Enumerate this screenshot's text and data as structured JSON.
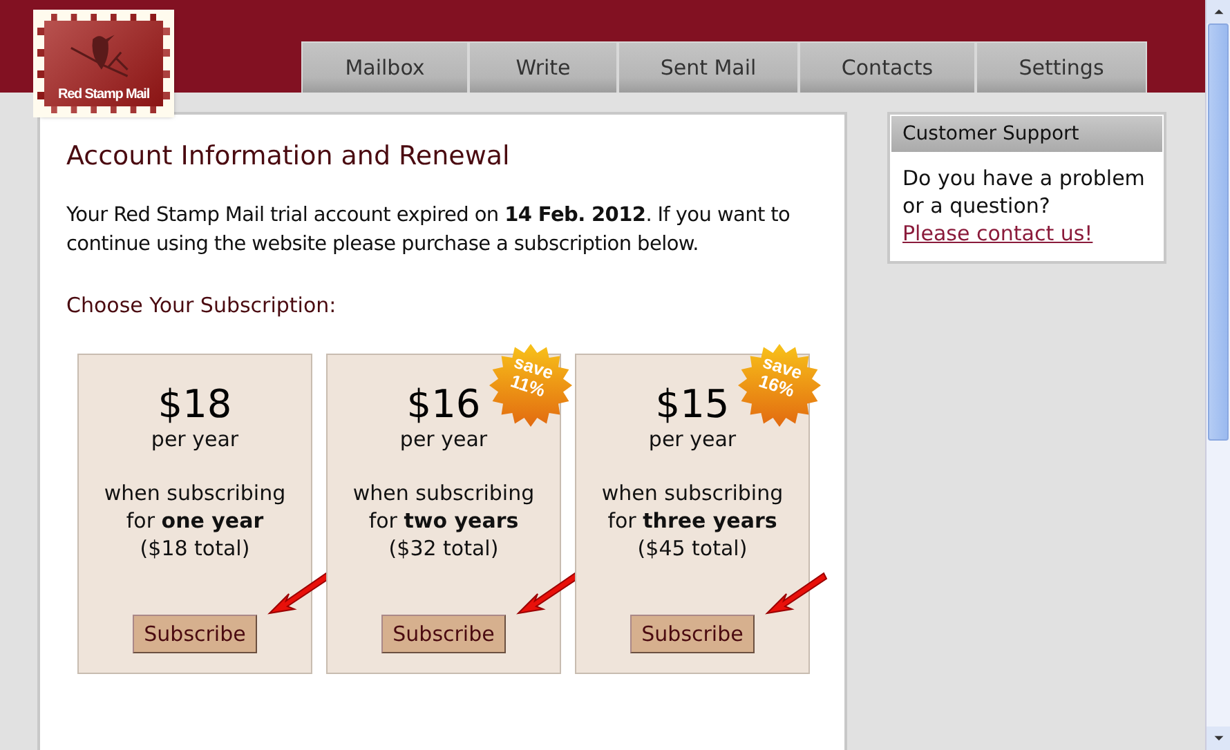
{
  "logo": {
    "text": "Red Stamp Mail"
  },
  "tabs": [
    {
      "label": "Mailbox",
      "selected": false
    },
    {
      "label": "Write",
      "selected": false
    },
    {
      "label": "Sent Mail",
      "selected": false
    },
    {
      "label": "Contacts",
      "selected": false
    },
    {
      "label": "Settings",
      "selected": false
    }
  ],
  "main": {
    "title": "Account Information and Renewal",
    "intro": "Your Red Stamp Mail trial account expired on **14 Feb. 2012**. If you want to continue using the website please purchase a subscription below.",
    "subscription_heading": "Choose Your Subscription:",
    "plans": [
      {
        "price": "$18",
        "period": "per year",
        "description": "when subscribing\nfor **one year**",
        "total": "($18 total)",
        "button": "Subscribe"
      },
      {
        "price": "$16",
        "period": "per year",
        "description": "when subscribing\nfor **two years**",
        "total": "($32 total)",
        "badge": [
          "save",
          "11%"
        ],
        "button": "Subscribe"
      },
      {
        "price": "$15",
        "period": "per year",
        "description": "when subscribing\nfor **three years**",
        "total": "($45 total)",
        "badge": [
          "save",
          "16%"
        ],
        "button": "Subscribe"
      }
    ]
  },
  "support": {
    "title": "Customer Support",
    "text": "Do you have a problem or a question?",
    "link": "Please contact us!"
  }
}
